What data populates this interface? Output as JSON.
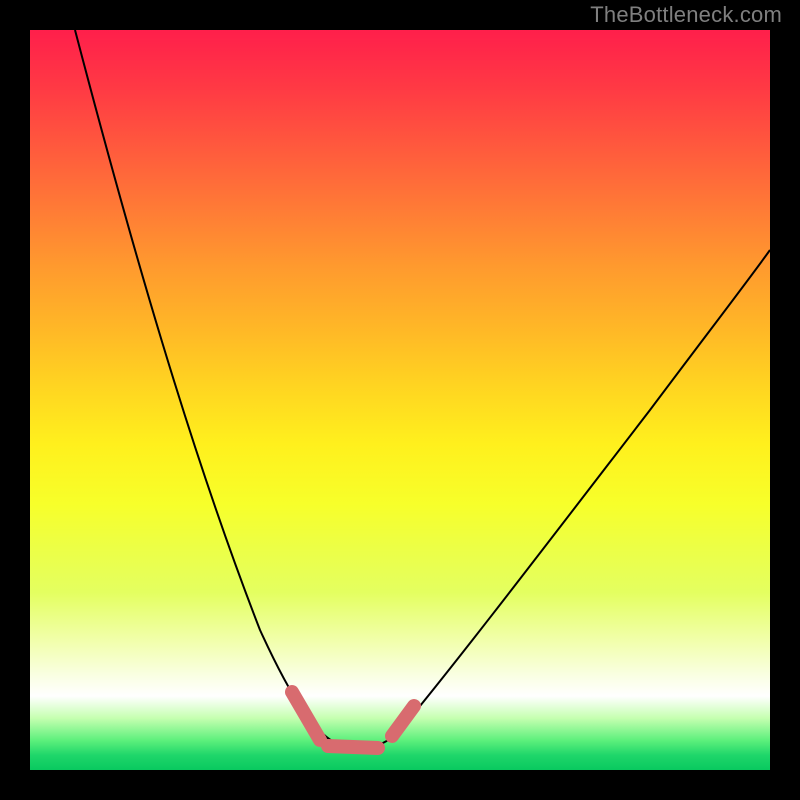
{
  "watermark": "TheBottleneck.com",
  "colors": {
    "frame": "#000000",
    "curve": "#000000",
    "dot_stroke": "#d86b6f",
    "watermark_text": "#7f7f7f"
  },
  "chart_data": {
    "type": "line",
    "title": "",
    "xlabel": "",
    "ylabel": "",
    "x_range": [
      0,
      100
    ],
    "y_range": [
      0,
      100
    ],
    "x": [
      0,
      5,
      10,
      15,
      20,
      25,
      30,
      35,
      40,
      45,
      50,
      55,
      60,
      65,
      70,
      75,
      80,
      85,
      90,
      95,
      100
    ],
    "values": [
      100,
      86,
      73,
      60,
      48,
      37,
      27,
      18,
      9,
      3,
      0,
      3,
      10,
      18,
      27,
      36,
      45,
      53,
      60,
      67,
      73
    ],
    "minimum_region_x": [
      38,
      52
    ],
    "notes": "Single black V-shaped curve on a vertical heatmap gradient (red=high, green=low). Pink rounded strokes highlight the region around the minimum. No axis ticks/labels rendered."
  }
}
